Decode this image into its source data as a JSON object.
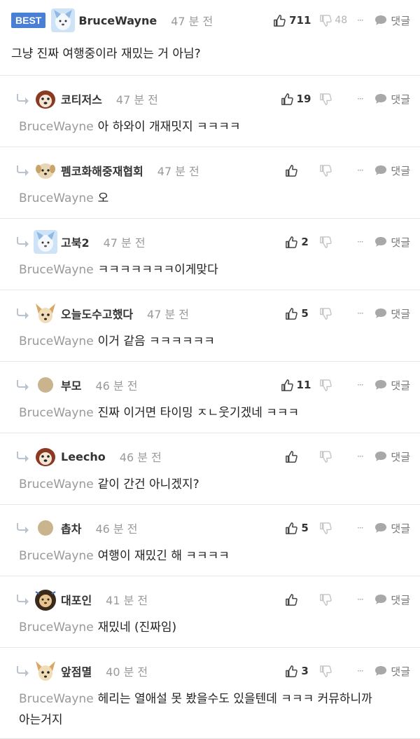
{
  "best_badge": "BEST",
  "best_comment": {
    "author": "BruceWayne",
    "time": "47 분 전",
    "likes": "711",
    "dislikes": "48",
    "more": "···",
    "reply_label": "댓글",
    "text": "그냥 진짜 여행중이라 재밌는 거 아님?"
  },
  "replies": [
    {
      "author": "코티저스",
      "time": "47 분 전",
      "likes": "19",
      "mention": "BruceWayne",
      "text": "아 하와이 개재밋지 ㅋㅋㅋㅋ",
      "more": "···",
      "reply_label": "댓글"
    },
    {
      "author": "펨코화해중재협회",
      "time": "47 분 전",
      "likes": "",
      "mention": "BruceWayne",
      "text": "오",
      "more": "···",
      "reply_label": "댓글"
    },
    {
      "author": "고북2",
      "time": "47 분 전",
      "likes": "2",
      "mention": "BruceWayne",
      "text": "ㅋㅋㅋㅋㅋㅋㅋ이게맞다",
      "more": "···",
      "reply_label": "댓글"
    },
    {
      "author": "오늘도수고했다",
      "time": "47 분 전",
      "likes": "5",
      "mention": "BruceWayne",
      "text": "이거 같음 ㅋㅋㅋㅋㅋㅋ",
      "more": "···",
      "reply_label": "댓글"
    },
    {
      "author": "부모",
      "time": "46 분 전",
      "likes": "11",
      "mention": "BruceWayne",
      "text": "진짜 이거면 타이밍 ㅈㄴ웃기겠네 ㅋㅋㅋ",
      "more": "···",
      "reply_label": "댓글"
    },
    {
      "author": "Leecho",
      "time": "46 분 전",
      "likes": "",
      "mention": "BruceWayne",
      "text": "같이 간건 아니겠지?",
      "more": "···",
      "reply_label": "댓글"
    },
    {
      "author": "촙차",
      "time": "46 분 전",
      "likes": "5",
      "mention": "BruceWayne",
      "text": "여행이 재밌긴 해 ㅋㅋㅋㅋ",
      "more": "···",
      "reply_label": "댓글"
    },
    {
      "author": "대포인",
      "time": "41 분 전",
      "likes": "",
      "mention": "BruceWayne",
      "text": "재밌네 (진짜임)",
      "more": "···",
      "reply_label": "댓글"
    },
    {
      "author": "앞점멸",
      "time": "40 분 전",
      "likes": "3",
      "mention": "BruceWayne",
      "text": "헤리는 열애설 못 봤을수도 있을텐데 ㅋㅋㅋ 커뮤하니까",
      "text2": "아는거지",
      "more": "···",
      "reply_label": "댓글"
    }
  ],
  "colors": {
    "best_badge": "#4a7fd6",
    "mention": "#9a9a9a",
    "divider": "#e6e6e6"
  },
  "icons": {
    "like": "thumbs-up-icon",
    "dislike": "thumbs-down-icon",
    "reply": "speech-bubble-icon",
    "reply_arrow": "reply-arrow-icon"
  }
}
